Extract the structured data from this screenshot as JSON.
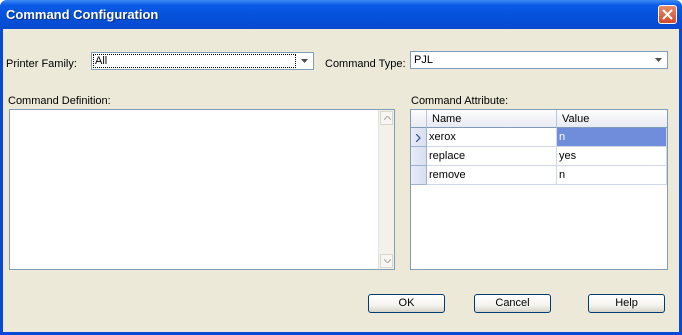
{
  "window": {
    "title": "Command Configuration"
  },
  "form": {
    "printer_family_label": "Printer Family:",
    "printer_family_value": "All",
    "command_type_label": "Command Type:",
    "command_type_value": "PJL",
    "command_definition_label": "Command Definition:",
    "command_definition_value": "",
    "command_attribute_label": "Command Attribute:"
  },
  "attributes": {
    "columns": [
      "Name",
      "Value"
    ],
    "rows": [
      {
        "name": "xerox",
        "value": "n"
      },
      {
        "name": "replace",
        "value": "yes"
      },
      {
        "name": "remove",
        "value": "n"
      }
    ],
    "selected_row": 0
  },
  "buttons": {
    "ok": "OK",
    "cancel": "Cancel",
    "help": "Help"
  },
  "colors": {
    "title_bar": "#0451d8",
    "selection": "#6f8ddb",
    "dialog_bg": "#ece9d8"
  }
}
